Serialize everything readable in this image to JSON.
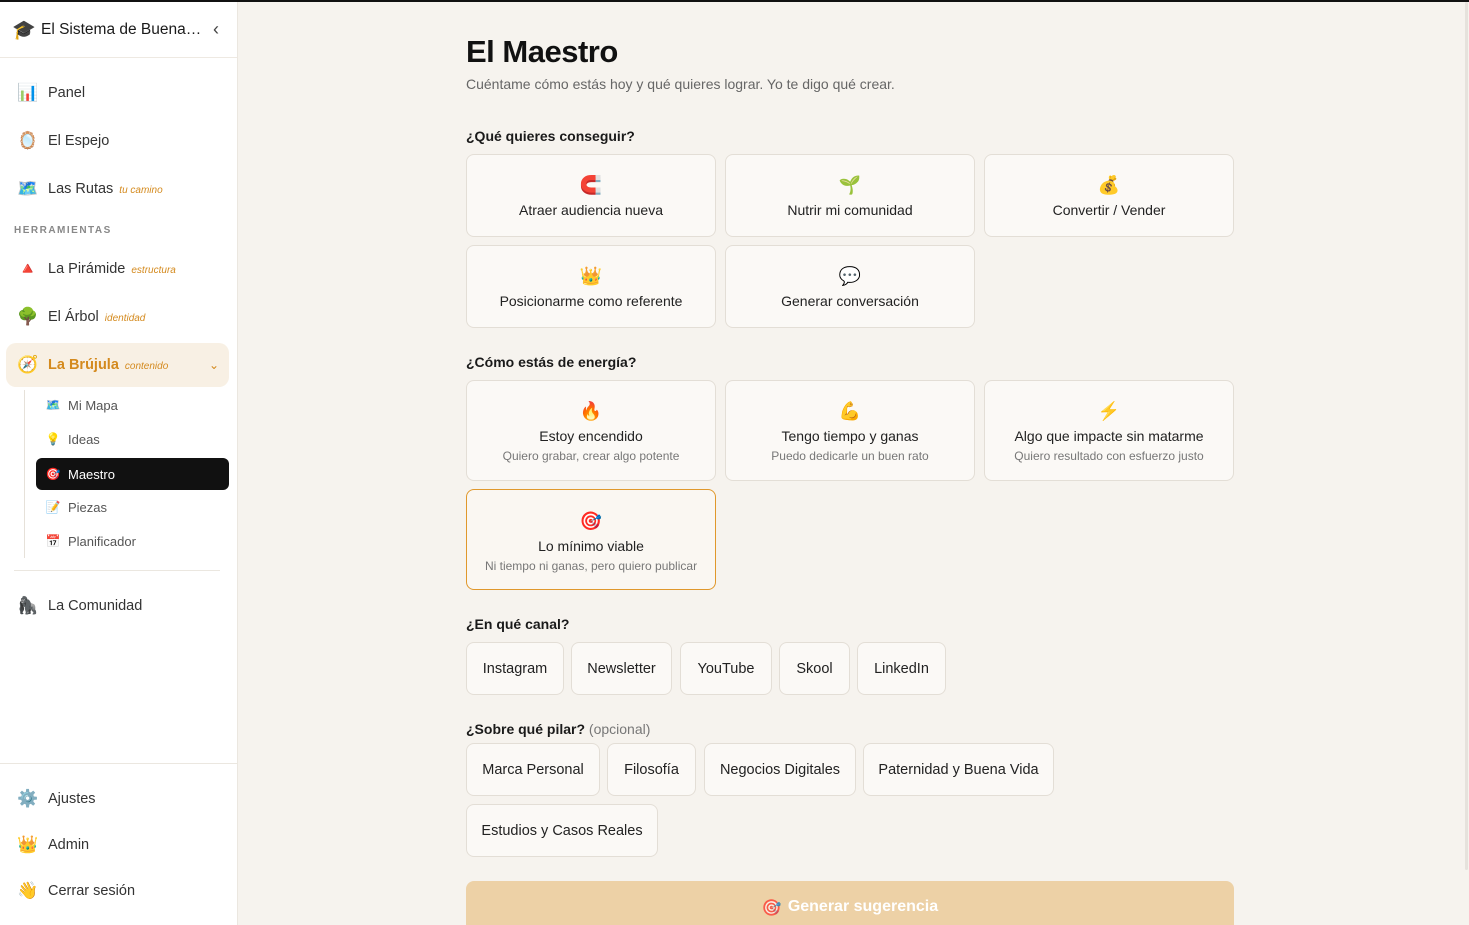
{
  "app": {
    "title": "El Sistema de Buena Vida",
    "icon": "graduation-cap-icon",
    "logo_emoji": "🎓",
    "collapse_glyph": "‹"
  },
  "sidebar": {
    "top_items": [
      {
        "emoji": "📊",
        "label": "Panel",
        "tag": ""
      },
      {
        "emoji": "🪞",
        "label": "El Espejo",
        "tag": ""
      },
      {
        "emoji": "🗺️",
        "label": "Las Rutas",
        "tag": "tu camino"
      }
    ],
    "section_label": "HERRAMIENTAS",
    "tools": [
      {
        "emoji": "🔺",
        "label": "La Pirámide",
        "tag": "estructura"
      },
      {
        "emoji": "🌳",
        "label": "El Árbol",
        "tag": "identidad"
      },
      {
        "emoji": "🧭",
        "label": "La Brújula",
        "tag": "contenido",
        "chevron": "⌄"
      }
    ],
    "sub_items": [
      {
        "emoji": "🗺️",
        "label": "Mi Mapa"
      },
      {
        "emoji": "💡",
        "label": "Ideas"
      },
      {
        "emoji": "🎯",
        "label": "Maestro"
      },
      {
        "emoji": "📝",
        "label": "Piezas"
      },
      {
        "emoji": "📅",
        "label": "Planificador"
      }
    ],
    "community": {
      "emoji": "🦍",
      "label": "La Comunidad"
    },
    "bottom_items": [
      {
        "emoji": "⚙️",
        "label": "Ajustes"
      },
      {
        "emoji": "👑",
        "label": "Admin"
      },
      {
        "emoji": "👋",
        "label": "Cerrar sesión"
      }
    ]
  },
  "main": {
    "title": "El Maestro",
    "subtitle": "Cuéntame cómo estás hoy y qué quieres lograr. Yo te digo qué crear.",
    "goal_question": "¿Qué quieres conseguir?",
    "goals": [
      {
        "emoji": "🧲",
        "label": "Atraer audiencia nueva"
      },
      {
        "emoji": "🌱",
        "label": "Nutrir mi comunidad"
      },
      {
        "emoji": "💰",
        "label": "Convertir / Vender"
      },
      {
        "emoji": "👑",
        "label": "Posicionarme como referente"
      },
      {
        "emoji": "💬",
        "label": "Generar conversación"
      }
    ],
    "energy_question": "¿Cómo estás de energía?",
    "energy": [
      {
        "emoji": "🔥",
        "label": "Estoy encendido",
        "sub": "Quiero grabar, crear algo potente"
      },
      {
        "emoji": "💪",
        "label": "Tengo tiempo y ganas",
        "sub": "Puedo dedicarle un buen rato"
      },
      {
        "emoji": "⚡",
        "label": "Algo que impacte sin matarme",
        "sub": "Quiero resultado con esfuerzo justo"
      },
      {
        "emoji": "🎯",
        "label": "Lo mínimo viable",
        "sub": "Ni tiempo ni ganas, pero quiero publicar"
      }
    ],
    "energy_selected": "Lo mínimo viable",
    "channel_question": "¿En qué canal?",
    "channels": [
      "Instagram",
      "Newsletter",
      "YouTube",
      "Skool",
      "LinkedIn"
    ],
    "pillar_question": "¿Sobre qué pilar?",
    "pillar_optional": "(opcional)",
    "pillars": [
      "Marca Personal",
      "Filosofía",
      "Negocios Digitales",
      "Paternidad y Buena Vida",
      "Estudios y Casos Reales"
    ],
    "generate_emoji": "🎯",
    "generate_label": "Generar sugerencia"
  },
  "colors": {
    "accent": "#d48a1e",
    "selected_border": "#e0982c",
    "button_disabled": "#edd1a6",
    "active_sub_bg": "#111111"
  }
}
